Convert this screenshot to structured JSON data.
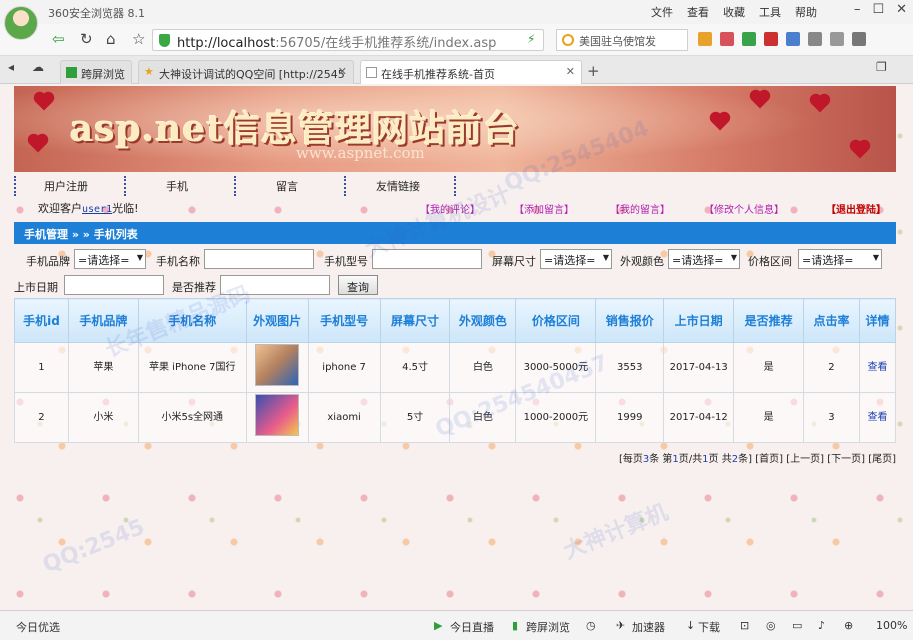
{
  "browser": {
    "app_title": "360安全浏览器 8.1",
    "menu": [
      "文件",
      "查看",
      "收藏",
      "工具",
      "帮助"
    ],
    "url_host": "http://localhost",
    "url_rest": ":56705/在线手机推荐系统/index.asp",
    "search_text": "美国驻乌使馆发",
    "tabs": [
      {
        "label": "跨屏浏览"
      },
      {
        "label": "大神设计调试的QQ空间 [http://2545"
      },
      {
        "label": "在线手机推荐系统-首页"
      }
    ]
  },
  "banner": {
    "title": "asp.net信息管理网站前台",
    "url": "www.aspnet.com"
  },
  "nav": {
    "items": [
      "用户注册",
      "手机",
      "留言",
      "友情链接"
    ]
  },
  "welcome": {
    "prefix": "欢迎客户",
    "user": "user1",
    "suffix": "光临!",
    "links": [
      "【我的评论】",
      "【添加留言】",
      "【我的留言】",
      "【修改个人信息】",
      "【退出登陆】"
    ]
  },
  "breadcrumb": "手机管理 » » 手机列表",
  "filters": {
    "brand_label": "手机品牌",
    "brand_value": "=请选择=",
    "name_label": "手机名称",
    "model_label": "手机型号",
    "screen_label": "屏幕尺寸",
    "screen_value": "=请选择=",
    "color_label": "外观颜色",
    "color_value": "=请选择=",
    "price_label": "价格区间",
    "price_value": "=请选择=",
    "date_label": "上市日期",
    "recommend_label": "是否推荐",
    "query_button": "查询"
  },
  "table": {
    "headers": [
      "手机id",
      "手机品牌",
      "手机名称",
      "外观图片",
      "手机型号",
      "屏幕尺寸",
      "外观颜色",
      "价格区间",
      "销售报价",
      "上市日期",
      "是否推荐",
      "点击率",
      "详情"
    ],
    "rows": [
      {
        "id": "1",
        "brand": "苹果",
        "name": "苹果 iPhone 7国行",
        "model": "iphone 7",
        "screen": "4.5寸",
        "color": "白色",
        "price_range": "3000-5000元",
        "price": "3553",
        "date": "2017-04-13",
        "recommend": "是",
        "clicks": "2",
        "detail": "查看"
      },
      {
        "id": "2",
        "brand": "小米",
        "name": "小米5s全网通",
        "model": "xiaomi",
        "screen": "5寸",
        "color": "白色",
        "price_range": "1000-2000元",
        "price": "1999",
        "date": "2017-04-12",
        "recommend": "是",
        "clicks": "3",
        "detail": "查看"
      }
    ]
  },
  "pager": {
    "text_a": "[每页",
    "per_page": "3",
    "text_b": "条 第",
    "current": "1",
    "text_c": "页/共",
    "pages": "1",
    "text_d": "页 共",
    "total": "2",
    "text_e": "条]",
    "first": "[首页]",
    "prev": "[上一页]",
    "next": "[下一页]",
    "last": "[尾页]"
  },
  "statusbar": {
    "left": "今日优选",
    "live": "今日直播",
    "cross": "跨屏浏览",
    "accel": "加速器",
    "download": "下载",
    "zoom": "100%"
  },
  "watermarks": [
    "大神计算机设计",
    "QQ:2545404",
    "长年售精品源码",
    "QQ:254540457",
    "大神计算机",
    "QQ:2545"
  ],
  "colors": {
    "header_blue": "#1d7fd6",
    "link_magenta": "#b020b0",
    "exit_red": "#c00000"
  }
}
